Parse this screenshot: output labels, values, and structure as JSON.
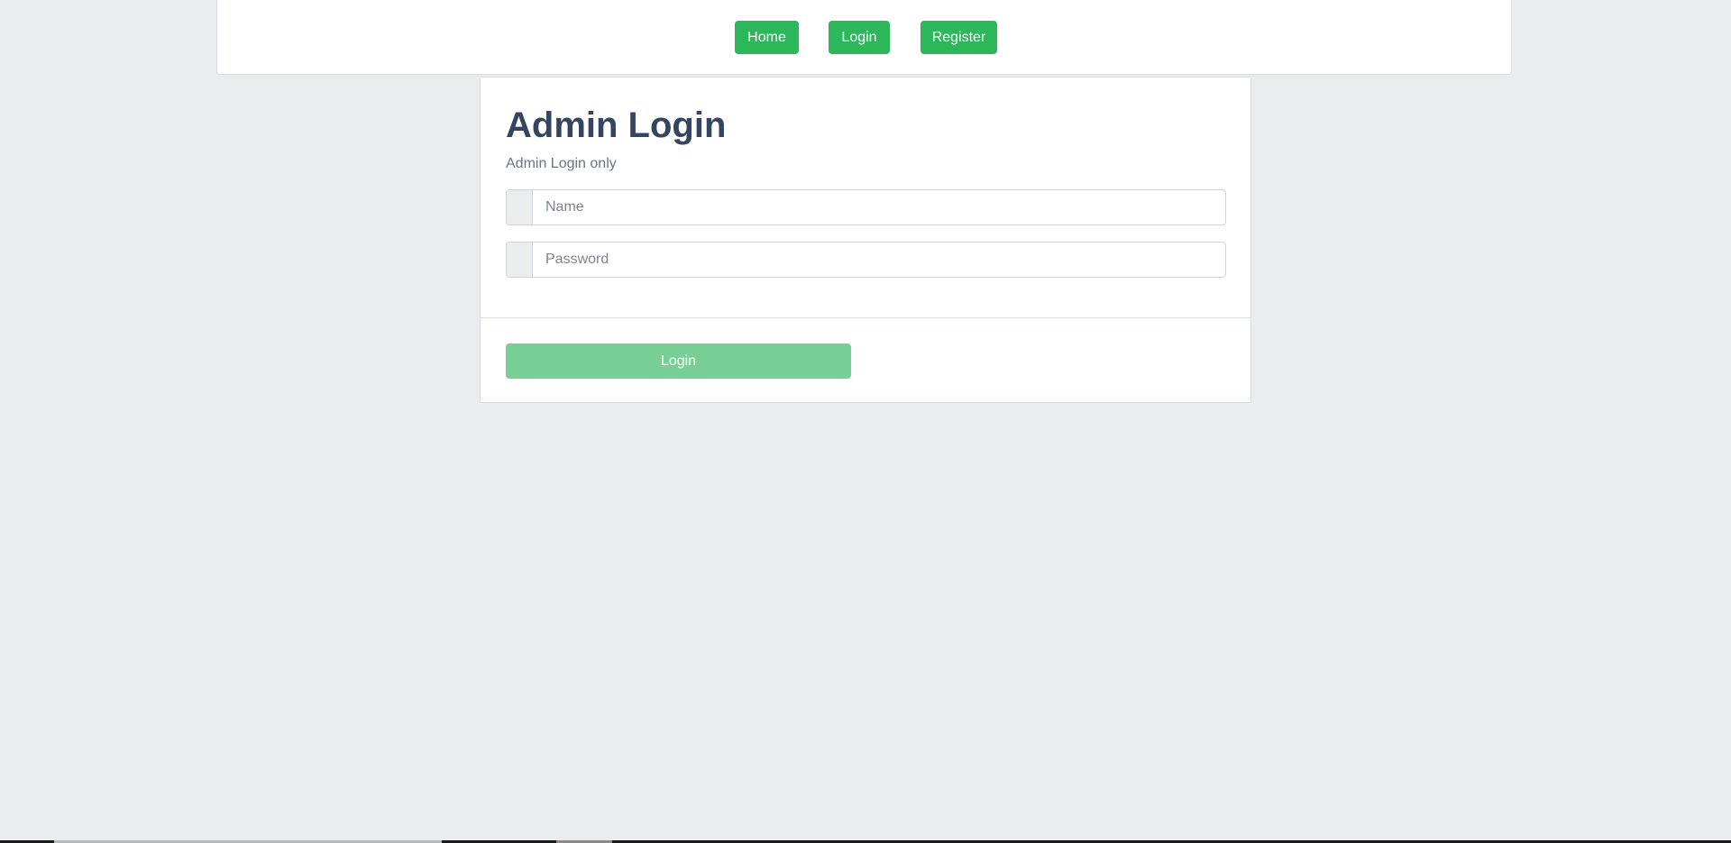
{
  "nav": {
    "home_label": "Home",
    "login_label": "Login",
    "register_label": "Register"
  },
  "card": {
    "title": "Admin Login",
    "subtitle": "Admin Login only",
    "name_placeholder": "Name",
    "password_placeholder": "Password",
    "submit_label": "Login"
  },
  "colors": {
    "page_background": "#ebecee",
    "primary_green": "#2bb75a",
    "disabled_green": "#77cf96",
    "title_text": "#334561"
  }
}
